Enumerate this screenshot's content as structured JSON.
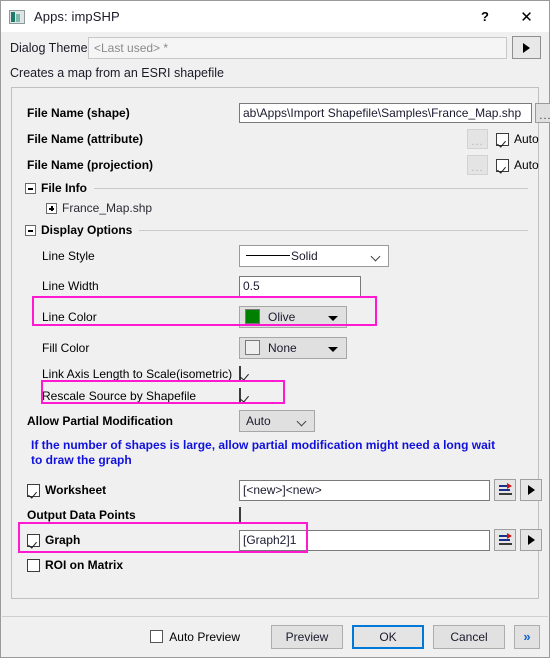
{
  "window": {
    "title": "Apps: impSHP",
    "icon": "app-window-icon",
    "help_label": "?",
    "close_label": "✕"
  },
  "theme": {
    "label": "Dialog Theme",
    "value": "",
    "placeholder": "<Last used> *",
    "go_icon": "play-triangle-icon"
  },
  "description": "Creates a map from an ESRI shapefile",
  "fields": {
    "shape": {
      "label": "File Name (shape)",
      "value": "ab\\Apps\\Import Shapefile\\Samples\\France_Map.shp",
      "browse_label": "..."
    },
    "attribute": {
      "label": "File Name (attribute)",
      "browse_label": "...",
      "auto_label": "Auto",
      "auto_checked": true
    },
    "projection": {
      "label": "File Name (projection)",
      "browse_label": "...",
      "auto_label": "Auto",
      "auto_checked": true
    }
  },
  "file_info": {
    "title": "File Info",
    "children": [
      {
        "name": "France_Map.shp"
      }
    ]
  },
  "display_options": {
    "title": "Display Options",
    "line_style": {
      "label": "Line Style",
      "value": "Solid"
    },
    "line_width": {
      "label": "Line Width",
      "value": "0.5"
    },
    "line_color": {
      "label": "Line Color",
      "value": "Olive",
      "swatch": "#008000",
      "highlighted": true
    },
    "fill_color": {
      "label": "Fill Color",
      "value": "None",
      "swatch": "#eeeeee"
    },
    "link_axis": {
      "label": "Link Axis Length to Scale(isometric)",
      "checked": true
    },
    "rescale": {
      "label": "Rescale Source by Shapefile",
      "checked": true,
      "highlighted": true
    },
    "allow_partial": {
      "label": "Allow Partial Modification",
      "value": "Auto"
    },
    "warning": "If the number of shapes is large, allow partial modification might need a long wait to draw the graph",
    "warning_color": "#1111dd"
  },
  "outputs": {
    "worksheet": {
      "label": "Worksheet",
      "checked": true,
      "value": "[<new>]<new>"
    },
    "output_data_points": {
      "label": "Output Data Points",
      "checked": false
    },
    "graph": {
      "label": "Graph",
      "checked": true,
      "value": "[Graph2]1",
      "highlighted": true
    },
    "roi_on_matrix": {
      "label": "ROI on Matrix",
      "checked": false
    }
  },
  "footer": {
    "auto_preview": {
      "label": "Auto Preview",
      "checked": false
    },
    "preview": "Preview",
    "ok": "OK",
    "cancel": "Cancel",
    "more": "»"
  },
  "highlight_color": "#ff19d0"
}
